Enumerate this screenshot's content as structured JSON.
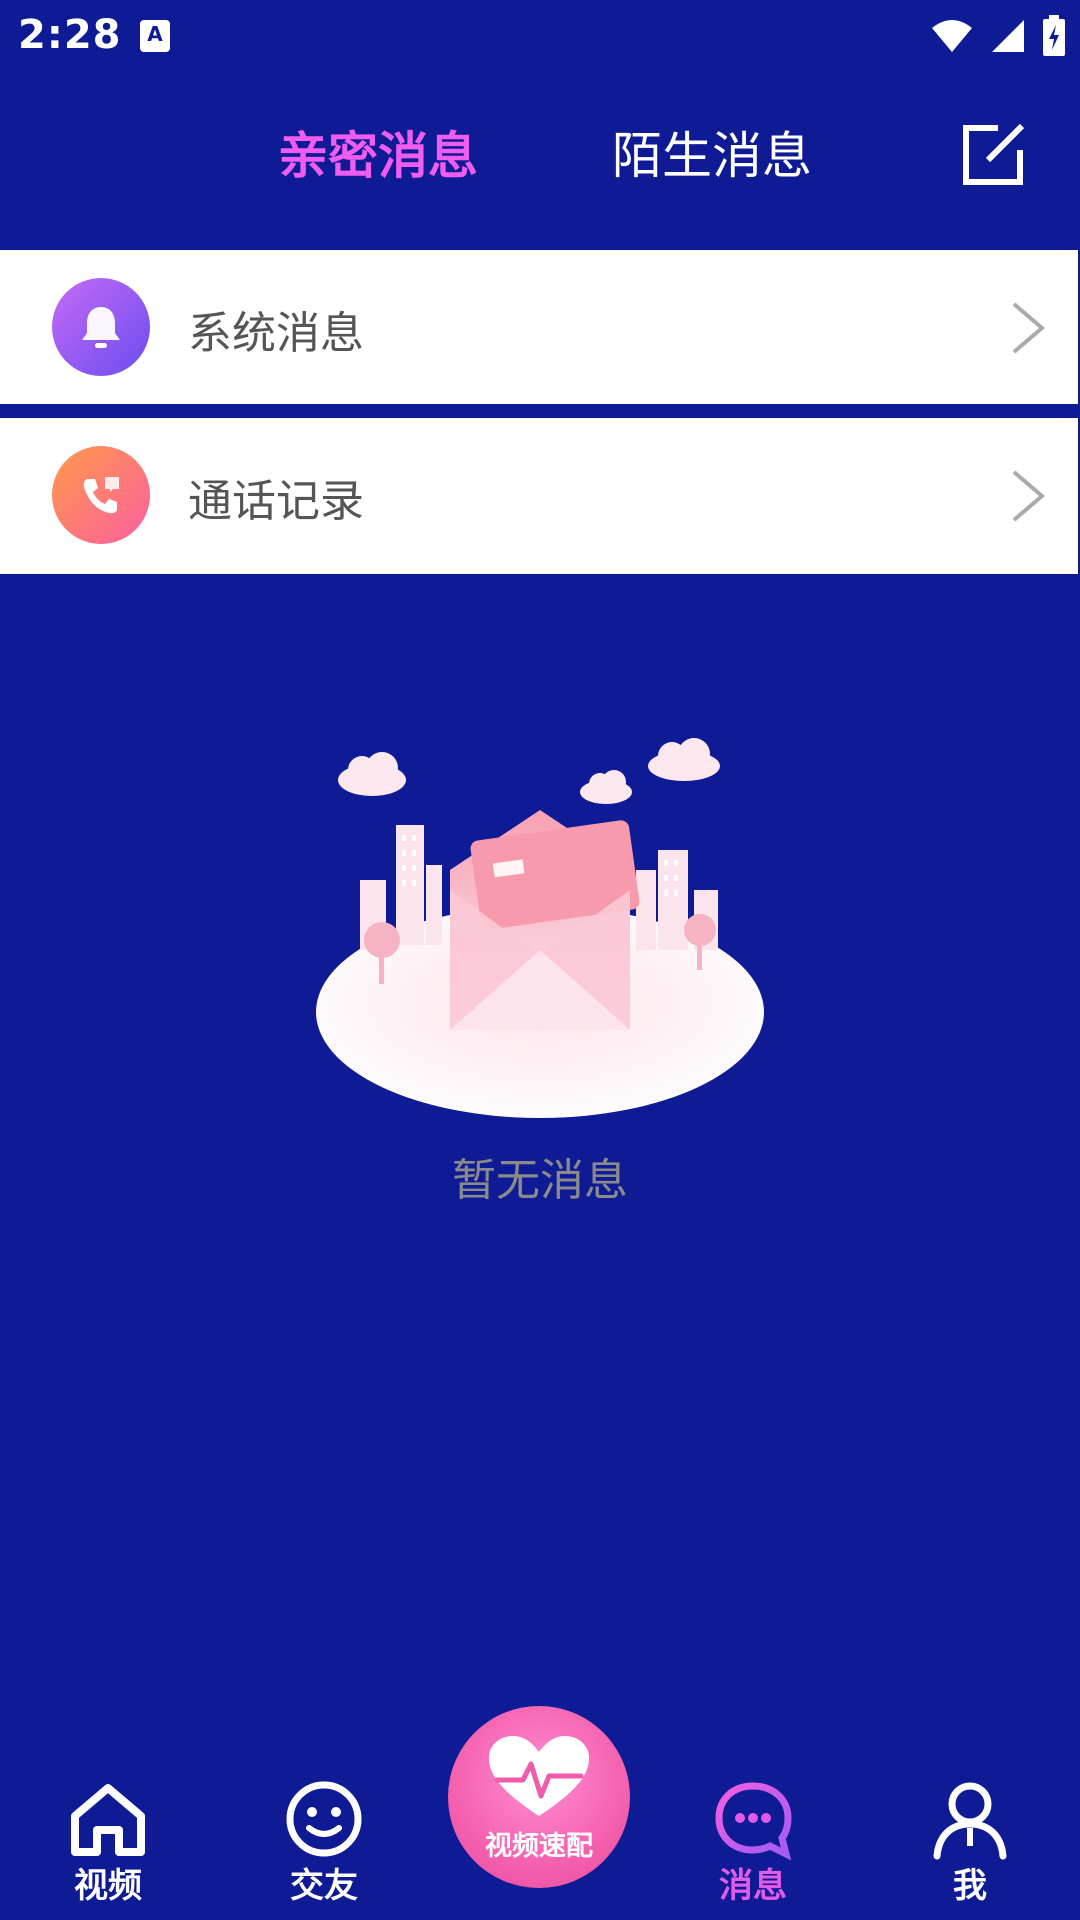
{
  "status_bar": {
    "time": "2:28",
    "app_badge": "A",
    "icons": [
      "wifi-icon",
      "cellular-signal-icon",
      "battery-charging-icon"
    ]
  },
  "header": {
    "tabs": [
      {
        "label": "亲密消息",
        "active": true
      },
      {
        "label": "陌生消息",
        "active": false
      }
    ],
    "compose_icon": "compose-icon"
  },
  "list": [
    {
      "label": "系统消息",
      "icon": "bell-icon"
    },
    {
      "label": "通话记录",
      "icon": "phone-icon"
    }
  ],
  "empty_state": {
    "text": "暂无消息",
    "illustration": "envelope-city-illustration"
  },
  "bottom_nav": {
    "items": [
      {
        "label": "视频",
        "icon": "home-icon",
        "active": false
      },
      {
        "label": "交友",
        "icon": "smiley-icon",
        "active": false
      },
      {
        "label": "消息",
        "icon": "chat-bubble-icon",
        "active": true
      },
      {
        "label": "我",
        "icon": "person-icon",
        "active": false
      }
    ],
    "center_button": {
      "label": "视频速配",
      "icon": "heartbeat-icon"
    }
  },
  "colors": {
    "background": "#0e1b94",
    "accent": "#ef5cf0",
    "center_button": "#f25aaa"
  }
}
